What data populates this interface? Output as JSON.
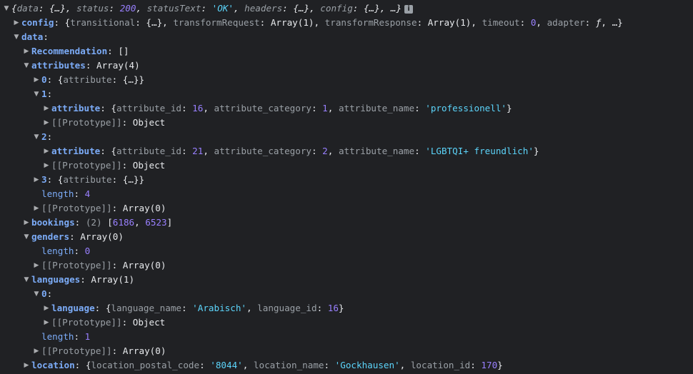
{
  "header": {
    "summary_parts": [
      {
        "t": "{",
        "c": "punct"
      },
      {
        "t": "data",
        "c": "key-plain"
      },
      {
        "t": ": {…}, ",
        "c": "punct"
      },
      {
        "t": "status",
        "c": "key-plain"
      },
      {
        "t": ": ",
        "c": "punct"
      },
      {
        "t": "200",
        "c": "num"
      },
      {
        "t": ", ",
        "c": "punct"
      },
      {
        "t": "statusText",
        "c": "key-plain"
      },
      {
        "t": ": ",
        "c": "punct"
      },
      {
        "t": "'OK'",
        "c": "str"
      },
      {
        "t": ", ",
        "c": "punct"
      },
      {
        "t": "headers",
        "c": "key-plain"
      },
      {
        "t": ": {…}, ",
        "c": "punct"
      },
      {
        "t": "config",
        "c": "key-plain"
      },
      {
        "t": ": {…}, …}",
        "c": "punct"
      }
    ],
    "info_badge": "i"
  },
  "rows": [
    {
      "indent": 1,
      "tri": "right",
      "parts": [
        {
          "t": "config",
          "c": "key-bold"
        },
        {
          "t": ": {",
          "c": "punct"
        },
        {
          "t": "transitional",
          "c": "key-plain"
        },
        {
          "t": ": {…}, ",
          "c": "punct"
        },
        {
          "t": "transformRequest",
          "c": "key-plain"
        },
        {
          "t": ": Array(1), ",
          "c": "punct"
        },
        {
          "t": "transformResponse",
          "c": "key-plain"
        },
        {
          "t": ": Array(1), ",
          "c": "punct"
        },
        {
          "t": "timeout",
          "c": "key-plain"
        },
        {
          "t": ": ",
          "c": "punct"
        },
        {
          "t": "0",
          "c": "num"
        },
        {
          "t": ", ",
          "c": "punct"
        },
        {
          "t": "adapter",
          "c": "key-plain"
        },
        {
          "t": ": ",
          "c": "punct"
        },
        {
          "t": "ƒ",
          "c": "italic"
        },
        {
          "t": ", …}",
          "c": "punct"
        }
      ]
    },
    {
      "indent": 1,
      "tri": "down",
      "parts": [
        {
          "t": "data",
          "c": "key-bold"
        },
        {
          "t": ":",
          "c": "punct"
        }
      ]
    },
    {
      "indent": 2,
      "tri": "right",
      "parts": [
        {
          "t": "Recommendation",
          "c": "key-bold"
        },
        {
          "t": ": []",
          "c": "punct"
        }
      ]
    },
    {
      "indent": 2,
      "tri": "down",
      "parts": [
        {
          "t": "attributes",
          "c": "key-bold"
        },
        {
          "t": ": Array(4)",
          "c": "punct"
        }
      ]
    },
    {
      "indent": 3,
      "tri": "right",
      "parts": [
        {
          "t": "0",
          "c": "key-idx"
        },
        {
          "t": ": {",
          "c": "punct"
        },
        {
          "t": "attribute",
          "c": "key-plain"
        },
        {
          "t": ": {…}}",
          "c": "punct"
        }
      ]
    },
    {
      "indent": 3,
      "tri": "down",
      "parts": [
        {
          "t": "1",
          "c": "key-idx"
        },
        {
          "t": ":",
          "c": "punct"
        }
      ]
    },
    {
      "indent": 4,
      "tri": "right",
      "parts": [
        {
          "t": "attribute",
          "c": "key-bold"
        },
        {
          "t": ": {",
          "c": "punct"
        },
        {
          "t": "attribute_id",
          "c": "key-plain"
        },
        {
          "t": ": ",
          "c": "punct"
        },
        {
          "t": "16",
          "c": "num"
        },
        {
          "t": ", ",
          "c": "punct"
        },
        {
          "t": "attribute_category",
          "c": "key-plain"
        },
        {
          "t": ": ",
          "c": "punct"
        },
        {
          "t": "1",
          "c": "num"
        },
        {
          "t": ", ",
          "c": "punct"
        },
        {
          "t": "attribute_name",
          "c": "key-plain"
        },
        {
          "t": ": ",
          "c": "punct"
        },
        {
          "t": "'professionell'",
          "c": "str"
        },
        {
          "t": "}",
          "c": "punct"
        }
      ]
    },
    {
      "indent": 4,
      "tri": "right",
      "parts": [
        {
          "t": "[[Prototype]]",
          "c": "proto"
        },
        {
          "t": ": Object",
          "c": "punct"
        }
      ]
    },
    {
      "indent": 3,
      "tri": "down",
      "parts": [
        {
          "t": "2",
          "c": "key-idx"
        },
        {
          "t": ":",
          "c": "punct"
        }
      ]
    },
    {
      "indent": 4,
      "tri": "right",
      "parts": [
        {
          "t": "attribute",
          "c": "key-bold"
        },
        {
          "t": ": {",
          "c": "punct"
        },
        {
          "t": "attribute_id",
          "c": "key-plain"
        },
        {
          "t": ": ",
          "c": "punct"
        },
        {
          "t": "21",
          "c": "num"
        },
        {
          "t": ", ",
          "c": "punct"
        },
        {
          "t": "attribute_category",
          "c": "key-plain"
        },
        {
          "t": ": ",
          "c": "punct"
        },
        {
          "t": "2",
          "c": "num"
        },
        {
          "t": ", ",
          "c": "punct"
        },
        {
          "t": "attribute_name",
          "c": "key-plain"
        },
        {
          "t": ": ",
          "c": "punct"
        },
        {
          "t": "'LGBTQI+ freundlich'",
          "c": "str"
        },
        {
          "t": "}",
          "c": "punct"
        }
      ]
    },
    {
      "indent": 4,
      "tri": "right",
      "parts": [
        {
          "t": "[[Prototype]]",
          "c": "proto"
        },
        {
          "t": ": Object",
          "c": "punct"
        }
      ]
    },
    {
      "indent": 3,
      "tri": "right",
      "parts": [
        {
          "t": "3",
          "c": "key-idx"
        },
        {
          "t": ": {",
          "c": "punct"
        },
        {
          "t": "attribute",
          "c": "key-plain"
        },
        {
          "t": ": {…}}",
          "c": "punct"
        }
      ]
    },
    {
      "indent": 3,
      "tri": "none",
      "parts": [
        {
          "t": "length",
          "c": "key-dim"
        },
        {
          "t": ": ",
          "c": "punct"
        },
        {
          "t": "4",
          "c": "num"
        }
      ]
    },
    {
      "indent": 3,
      "tri": "right",
      "parts": [
        {
          "t": "[[Prototype]]",
          "c": "proto"
        },
        {
          "t": ": Array(0)",
          "c": "punct"
        }
      ]
    },
    {
      "indent": 2,
      "tri": "right",
      "parts": [
        {
          "t": "bookings",
          "c": "key-bold"
        },
        {
          "t": ": ",
          "c": "punct"
        },
        {
          "t": "(2) ",
          "c": "key-plain"
        },
        {
          "t": "[",
          "c": "punct"
        },
        {
          "t": "6186",
          "c": "num"
        },
        {
          "t": ", ",
          "c": "punct"
        },
        {
          "t": "6523",
          "c": "num"
        },
        {
          "t": "]",
          "c": "punct"
        }
      ]
    },
    {
      "indent": 2,
      "tri": "down",
      "parts": [
        {
          "t": "genders",
          "c": "key-bold"
        },
        {
          "t": ": Array(0)",
          "c": "punct"
        }
      ]
    },
    {
      "indent": 3,
      "tri": "none",
      "parts": [
        {
          "t": "length",
          "c": "key-dim"
        },
        {
          "t": ": ",
          "c": "punct"
        },
        {
          "t": "0",
          "c": "num"
        }
      ]
    },
    {
      "indent": 3,
      "tri": "right",
      "parts": [
        {
          "t": "[[Prototype]]",
          "c": "proto"
        },
        {
          "t": ": Array(0)",
          "c": "punct"
        }
      ]
    },
    {
      "indent": 2,
      "tri": "down",
      "parts": [
        {
          "t": "languages",
          "c": "key-bold"
        },
        {
          "t": ": Array(1)",
          "c": "punct"
        }
      ]
    },
    {
      "indent": 3,
      "tri": "down",
      "parts": [
        {
          "t": "0",
          "c": "key-idx"
        },
        {
          "t": ":",
          "c": "punct"
        }
      ]
    },
    {
      "indent": 4,
      "tri": "right",
      "parts": [
        {
          "t": "language",
          "c": "key-bold"
        },
        {
          "t": ": {",
          "c": "punct"
        },
        {
          "t": "language_name",
          "c": "key-plain"
        },
        {
          "t": ": ",
          "c": "punct"
        },
        {
          "t": "'Arabisch'",
          "c": "str"
        },
        {
          "t": ", ",
          "c": "punct"
        },
        {
          "t": "language_id",
          "c": "key-plain"
        },
        {
          "t": ": ",
          "c": "punct"
        },
        {
          "t": "16",
          "c": "num"
        },
        {
          "t": "}",
          "c": "punct"
        }
      ]
    },
    {
      "indent": 4,
      "tri": "right",
      "parts": [
        {
          "t": "[[Prototype]]",
          "c": "proto"
        },
        {
          "t": ": Object",
          "c": "punct"
        }
      ]
    },
    {
      "indent": 3,
      "tri": "none",
      "parts": [
        {
          "t": "length",
          "c": "key-dim"
        },
        {
          "t": ": ",
          "c": "punct"
        },
        {
          "t": "1",
          "c": "num"
        }
      ]
    },
    {
      "indent": 3,
      "tri": "right",
      "parts": [
        {
          "t": "[[Prototype]]",
          "c": "proto"
        },
        {
          "t": ": Array(0)",
          "c": "punct"
        }
      ]
    },
    {
      "indent": 2,
      "tri": "right",
      "parts": [
        {
          "t": "location",
          "c": "key-bold"
        },
        {
          "t": ": {",
          "c": "punct"
        },
        {
          "t": "location_postal_code",
          "c": "key-plain"
        },
        {
          "t": ": ",
          "c": "punct"
        },
        {
          "t": "'8044'",
          "c": "str"
        },
        {
          "t": ", ",
          "c": "punct"
        },
        {
          "t": "location_name",
          "c": "key-plain"
        },
        {
          "t": ": ",
          "c": "punct"
        },
        {
          "t": "'Gockhausen'",
          "c": "str"
        },
        {
          "t": ", ",
          "c": "punct"
        },
        {
          "t": "location_id",
          "c": "key-plain"
        },
        {
          "t": ": ",
          "c": "punct"
        },
        {
          "t": "170",
          "c": "num"
        },
        {
          "t": "}",
          "c": "punct"
        }
      ]
    }
  ],
  "colors": {
    "background": "#202124",
    "key": "#7cacf8",
    "string": "#5cd5fb",
    "number": "#9980ff",
    "dim": "#9aa0a6"
  }
}
